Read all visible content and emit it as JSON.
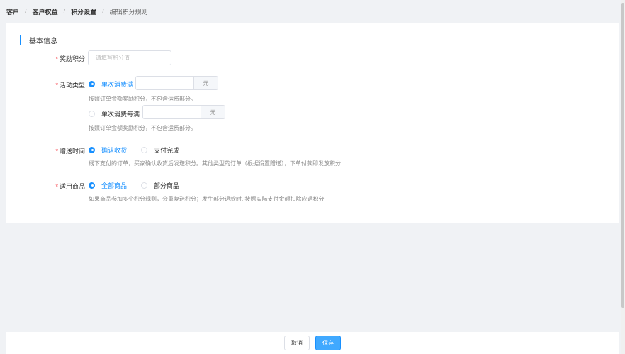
{
  "breadcrumb": {
    "items": [
      "客户",
      "客户权益",
      "积分设置",
      "编辑积分规则"
    ],
    "separator": "/"
  },
  "section": {
    "title": "基本信息"
  },
  "form": {
    "required_mark": "*",
    "points": {
      "label": "奖励积分",
      "placeholder": "请填写积分值"
    },
    "activity_type": {
      "label": "活动类型",
      "options": [
        {
          "label": "单次消费满",
          "checked": true,
          "unit": "元",
          "hint": "按照订单金额奖励积分，不包含运费部分。"
        },
        {
          "label": "单次消费每满",
          "checked": false,
          "unit": "元",
          "hint": "按照订单金额奖励积分，不包含运费部分。"
        }
      ]
    },
    "gift_time": {
      "label": "赠送时间",
      "options": [
        {
          "label": "确认收货",
          "checked": true
        },
        {
          "label": "支付完成",
          "checked": false
        }
      ],
      "hint": "线下支付的订单，买家确认收货后发送积分。其他类型的订单（根据设置赠送），下单付款即发放积分"
    },
    "products": {
      "label": "适用商品",
      "options": [
        {
          "label": "全部商品",
          "checked": true
        },
        {
          "label": "部分商品",
          "checked": false
        }
      ],
      "hint": "如果商品参加多个积分规则，会重复送积分；发生部分退款时, 按照实际支付金额扣除应退积分"
    }
  },
  "footer": {
    "cancel_label": "取消",
    "save_label": "保存"
  },
  "colors": {
    "accent": "#1890ff",
    "required": "#f5222d",
    "background": "#f0f2f5"
  }
}
